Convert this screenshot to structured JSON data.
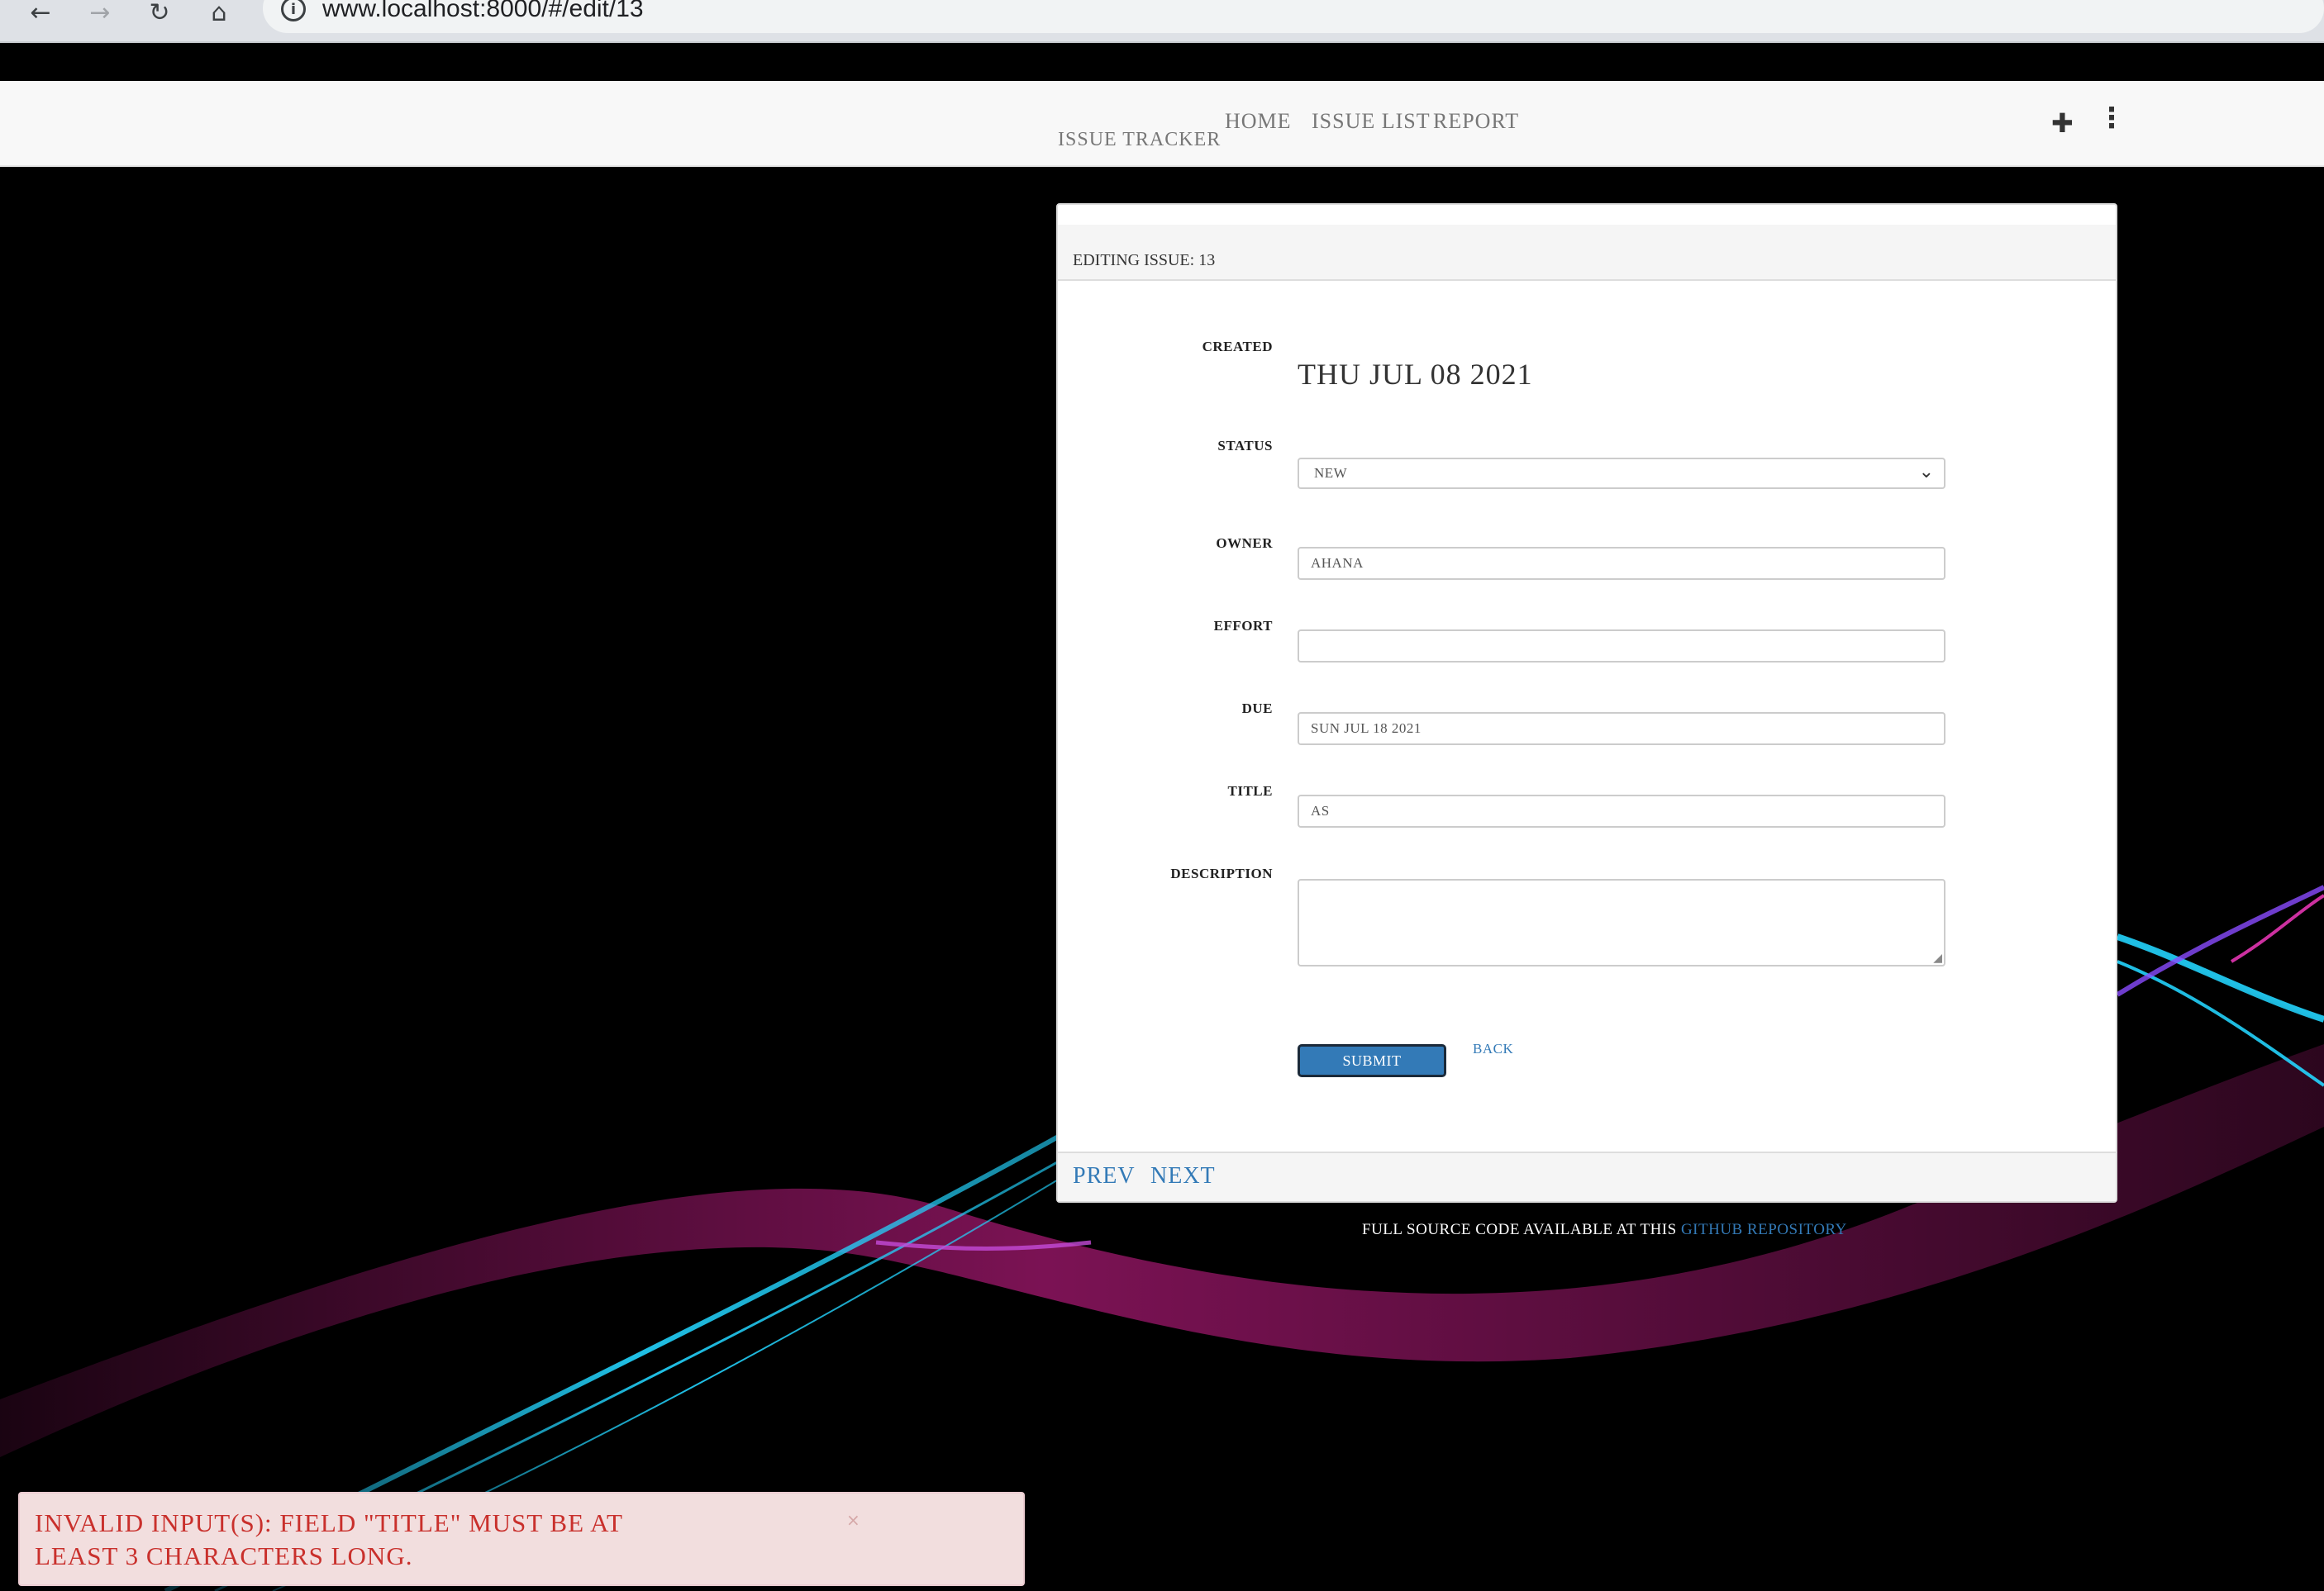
{
  "browser": {
    "url": "www.localhost:8000/#/edit/13",
    "back_icon": "←",
    "forward_icon": "→",
    "reload_icon": "↻",
    "home_icon": "⌂",
    "info_icon": "i"
  },
  "navbar": {
    "brand": "ISSUE TRACKER",
    "links": [
      "HOME",
      "ISSUE LIST",
      "REPORT"
    ],
    "plus_icon": "✚",
    "menu_icon": "⋮"
  },
  "panel": {
    "heading": "EDITING ISSUE: 13",
    "fields": {
      "created_label": "CREATED",
      "created_value": "THU JUL 08 2021",
      "status_label": "STATUS",
      "status_value": "NEW",
      "owner_label": "OWNER",
      "owner_value": "AHANA",
      "effort_label": "EFFORT",
      "effort_value": "",
      "due_label": "DUE",
      "due_value": "SUN JUL 18 2021",
      "title_label": "TITLE",
      "title_value": "AS",
      "description_label": "DESCRIPTION",
      "description_value": ""
    },
    "submit_label": "SUBMIT",
    "back_label": "BACK",
    "prev_label": "PREV",
    "next_label": "NEXT"
  },
  "footer": {
    "text": "FULL SOURCE CODE AVAILABLE AT THIS ",
    "link": "GITHUB REPOSITORY"
  },
  "toast": {
    "message": "INVALID INPUT(S): FIELD \"TITLE\" MUST BE AT LEAST 3 CHARACTERS LONG.",
    "close_icon": "×"
  },
  "colors": {
    "background": "#000000",
    "link": "#337ab7",
    "toast_bg": "#f2dede",
    "toast_text": "#c9302c",
    "wave_cyan": "#23d5ff",
    "wave_magenta": "#b01a78"
  }
}
